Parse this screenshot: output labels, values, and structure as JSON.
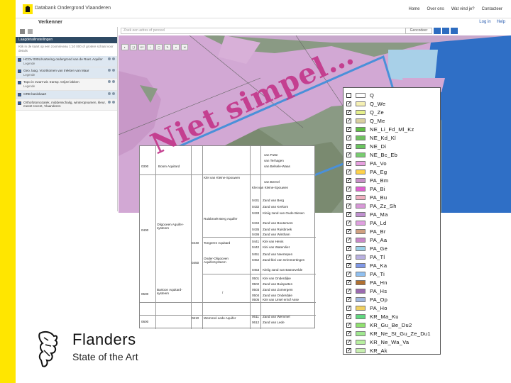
{
  "app": {
    "title": "Databank Ondergrond Vlaanderen",
    "module": "Verkenner",
    "top_nav": [
      "Home",
      "Over ons",
      "Wat vind je?",
      "Contacteer"
    ],
    "user_links": [
      "Log in",
      "Help"
    ]
  },
  "left_panel": {
    "section_title": "Laagdetailinstellingen",
    "note": "Klik in de kaart op een zoomniveau 1:10 000 of grotere schaal voor details",
    "layers": [
      {
        "label": "HCOv 000L/Kartering ondergrond van de Roet. Aquifer",
        "sub": "Legende",
        "checked": true
      },
      {
        "label": "Geo. laag. Voortkomen van trekken van Maar",
        "sub": "Legende",
        "checked": true
      },
      {
        "label": "Topo in zwart-wit. transp. Grijze lakken",
        "sub": "Legende",
        "checked": true
      },
      {
        "label": "GRB basiskaart",
        "sub": "",
        "checked": true
      },
      {
        "label": "Orthofotomozaïek, middenschalig, winteropnamen, kleur, meest recent, Vlaanderen",
        "sub": "",
        "checked": true
      }
    ]
  },
  "map": {
    "search_placeholder": "Zoek een adres of perceel",
    "search_button": "Geocodeer",
    "tools": [
      "◐",
      "❏",
      "XY",
      "i",
      "▢",
      "✎",
      "⌕",
      "⇲"
    ]
  },
  "legend": {
    "items": [
      {
        "label": "Q",
        "color": "#ffffff",
        "checked": false
      },
      {
        "label": "Q_We",
        "color": "#f5f0b4",
        "checked": true
      },
      {
        "label": "Q_Ze",
        "color": "#e6f08c",
        "checked": true
      },
      {
        "label": "Q_Me",
        "color": "#d9d0a0",
        "checked": true
      },
      {
        "label": "NE_Li_Fd_Ml_Kz",
        "color": "#5fbf45",
        "checked": true
      },
      {
        "label": "NE_Kd_Kl",
        "color": "#70c060",
        "checked": true
      },
      {
        "label": "NE_Di",
        "color": "#6ac55f",
        "checked": true
      },
      {
        "label": "NE_Bc_Eb",
        "color": "#78cc70",
        "checked": true
      },
      {
        "label": "PA_Vo",
        "color": "#e8a0e0",
        "checked": true
      },
      {
        "label": "PA_Eg",
        "color": "#ffd24a",
        "checked": true
      },
      {
        "label": "PA_Bm",
        "color": "#c890c8",
        "checked": true
      },
      {
        "label": "PA_Bi",
        "color": "#e060d0",
        "checked": true
      },
      {
        "label": "PA_Bu",
        "color": "#f0b0c0",
        "checked": true
      },
      {
        "label": "PA_Zz_Sh",
        "color": "#d898d8",
        "checked": true
      },
      {
        "label": "PA_Ma",
        "color": "#c090d0",
        "checked": true
      },
      {
        "label": "PA_Ld",
        "color": "#e0a0e0",
        "checked": true
      },
      {
        "label": "PA_Br",
        "color": "#d0a080",
        "checked": true
      },
      {
        "label": "PA_Aa",
        "color": "#c888c8",
        "checked": true
      },
      {
        "label": "PA_Ge",
        "color": "#9ad0e8",
        "checked": true
      },
      {
        "label": "PA_Tl",
        "color": "#b8b0e0",
        "checked": true
      },
      {
        "label": "PA_Ka",
        "color": "#8098e8",
        "checked": true
      },
      {
        "label": "PA_Ti",
        "color": "#90c0f0",
        "checked": true
      },
      {
        "label": "PA_Hn",
        "color": "#b07030",
        "checked": true
      },
      {
        "label": "PA_Hs",
        "color": "#9b6bb0",
        "checked": true
      },
      {
        "label": "PA_Op",
        "color": "#a0b8e0",
        "checked": true
      },
      {
        "label": "PA_Ho",
        "color": "#f0d060",
        "checked": true
      },
      {
        "label": "KR_Ma_Ku",
        "color": "#60d880",
        "checked": true
      },
      {
        "label": "KR_Gu_Be_Du2",
        "color": "#90e070",
        "checked": true
      },
      {
        "label": "KR_Ne_St_Gu_Ze_Du1",
        "color": "#a0e890",
        "checked": true
      },
      {
        "label": "KR_Ne_Wa_Va",
        "color": "#b8f0a0",
        "checked": true
      },
      {
        "label": "KR_Ak",
        "color": "#c8f0b0",
        "checked": true
      }
    ]
  },
  "strat_table": {
    "rows": [
      {
        "code": "0300",
        "group": "Boom Aquitard",
        "sub": "",
        "members": [
          [
            "",
            "van Putte"
          ],
          [
            "",
            "van Terhagen"
          ],
          [
            "",
            "van Belsele-Waas"
          ]
        ]
      },
      {
        "code": "0400",
        "group": "Oligoceen Aquifer-systeem",
        "sub": "Klei van Kleine-Spouwen",
        "members": [
          [
            "",
            "van Bernel"
          ],
          [
            "",
            "Klei van Kleine-Spouwen"
          ],
          [
            "0431",
            "Zand van Berg"
          ],
          [
            "0432",
            "Zand van Kerkom"
          ],
          [
            "0433",
            "Kleiig zand van Oude Biesen"
          ],
          [
            "0434",
            "Zand van Boutersem"
          ],
          [
            "0435",
            "Zand van Ruisbroek"
          ],
          [
            "0436",
            "Zand van Wintham"
          ]
        ]
      },
      {
        "code": "",
        "group": "",
        "sub": "Ruisbroek-Berg Aquifer",
        "members": []
      },
      {
        "code": "0440",
        "group": "",
        "sub": "Tongeren Aquitard",
        "members": [
          [
            "0441",
            "Klei van Henis"
          ],
          [
            "0442",
            "Klei van Watervliet"
          ]
        ]
      },
      {
        "code": "0450",
        "group": "",
        "sub": "Onder-Oligoceen Aquifersysteem",
        "members": [
          [
            "0451",
            "Zand van Neerrepen"
          ],
          [
            "0452",
            "Zand-klei van Grimmertingen"
          ],
          [
            "0453",
            "Kleiig zand van Bassevelde"
          ]
        ]
      },
      {
        "code": "0500",
        "group": "Bartoon Aquitard-systeem",
        "sub": "/",
        "members": [
          [
            "0501",
            "Klei van Onderdijke"
          ],
          [
            "0502",
            "Zand van Buisputten"
          ],
          [
            "0503",
            "Zand van Zomergem"
          ],
          [
            "0504",
            "Zand van Onderdale"
          ],
          [
            "0505",
            "Klei van Ursel en/of Asse"
          ]
        ]
      },
      {
        "code": "0600",
        "group": "",
        "sub": "Wemmel-Lede Aquifer",
        "members": [
          [
            "0610",
            ""
          ],
          [
            "0611",
            "Zand van Wemmel"
          ],
          [
            "0612",
            "Zand van Lede"
          ]
        ]
      }
    ]
  },
  "watermark": "Niet simpel…",
  "brand": {
    "name": "Flanders",
    "tagline": "State of the Art"
  }
}
